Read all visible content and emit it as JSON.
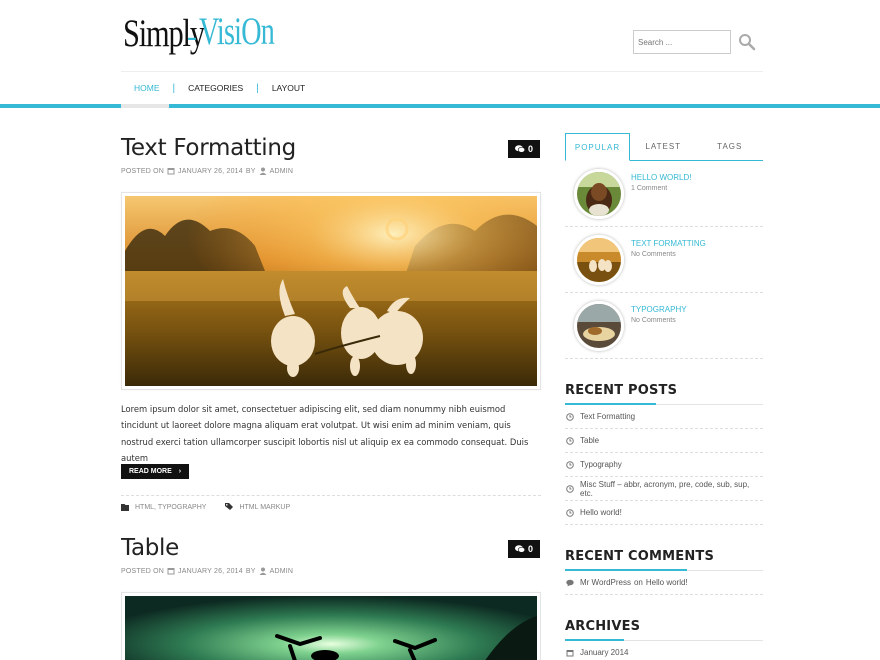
{
  "site": {
    "logo_part1": "Simply",
    "logo_part2": "VisiOn",
    "search_placeholder": "Search ..."
  },
  "nav": {
    "items": [
      {
        "label": "HOME",
        "active": true
      },
      {
        "label": "CATEGORIES",
        "active": false
      },
      {
        "label": "LAYOUT",
        "active": false
      }
    ],
    "separator": "|"
  },
  "posts": [
    {
      "title": "Text Formatting",
      "comments": "0",
      "posted_on_label": "POSTED ON",
      "date": "JANUARY 26, 2014",
      "by_label": "BY",
      "author": "ADMIN",
      "excerpt": "Lorem ipsum dolor sit amet, consectetuer adipiscing elit, sed diam nonummy nibh euismod tincidunt ut laoreet dolore magna aliquam erat volutpat. Ut wisi enim ad minim veniam, quis nostrud exerci tation ullamcorper suscipit lobortis nisl ut aliquip ex ea commodo consequat. Duis autem",
      "read_more": "READ MORE",
      "categories": "HTML, TYPOGRAPHY",
      "tags": "HTML MARKUP"
    },
    {
      "title": "Table",
      "comments": "0",
      "posted_on_label": "POSTED ON",
      "date": "JANUARY 26, 2014",
      "by_label": "BY",
      "author": "ADMIN"
    }
  ],
  "sidebar": {
    "tabs": [
      {
        "label": "POPULAR",
        "active": true
      },
      {
        "label": "LATEST",
        "active": false
      },
      {
        "label": "TAGS",
        "active": false
      }
    ],
    "popular": [
      {
        "title": "HELLO WORLD!",
        "meta": "1 Comment"
      },
      {
        "title": "TEXT FORMATTING",
        "meta": "No Comments"
      },
      {
        "title": "TYPOGRAPHY",
        "meta": "No Comments"
      }
    ],
    "recent_posts_title": "RECENT POSTS",
    "recent_posts": [
      "Text Formatting",
      "Table",
      "Typography",
      "Misc Stuff – abbr, acronym, pre, code, sub, sup, etc.",
      "Hello world!"
    ],
    "recent_comments_title": "RECENT COMMENTS",
    "recent_comments": [
      {
        "author": "Mr WordPress",
        "on_label": "on",
        "post": "Hello world!"
      }
    ],
    "archives_title": "ARCHIVES",
    "archives": [
      "January 2014"
    ]
  },
  "colors": {
    "accent": "#35b9d4",
    "dark": "#111111",
    "text": "#333333",
    "meta": "#888888"
  }
}
